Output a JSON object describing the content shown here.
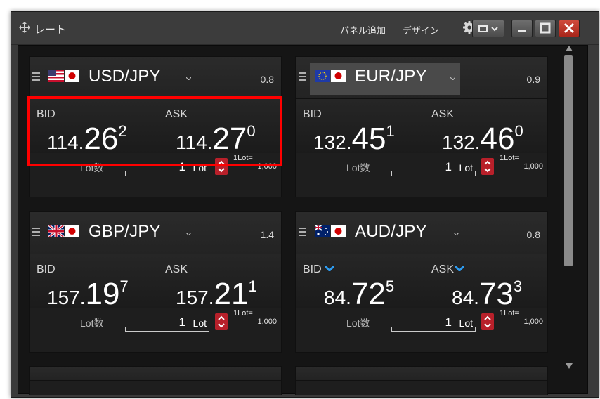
{
  "window": {
    "title": "レート",
    "add_panel_label": "パネル追加",
    "design_label": "デザイン"
  },
  "colors": {
    "accent_red": "#b8202a",
    "highlight": "#ff0000",
    "down_arrow_blue": "#2e9cf0"
  },
  "panels": [
    {
      "pair": "USD/JPY",
      "spread": "0.8",
      "flags": [
        "flag-us-icon",
        "flag-jp-icon"
      ],
      "bid_label": "BID",
      "ask_label": "ASK",
      "bid": {
        "prefix": "114.",
        "main": "26",
        "pip": "2"
      },
      "ask": {
        "prefix": "114.",
        "main": "27",
        "pip": "0"
      },
      "lot_label": "Lot数",
      "lot_value": "1",
      "lot_unit": "Lot",
      "lot_note_1": "1Lot=",
      "lot_note_2": "1,000"
    },
    {
      "pair": "EUR/JPY",
      "spread": "0.9",
      "flags": [
        "flag-eu-icon",
        "flag-jp-icon"
      ],
      "bid_label": "BID",
      "ask_label": "ASK",
      "bid": {
        "prefix": "132.",
        "main": "45",
        "pip": "1"
      },
      "ask": {
        "prefix": "132.",
        "main": "46",
        "pip": "0"
      },
      "lot_label": "Lot数",
      "lot_value": "1",
      "lot_unit": "Lot",
      "lot_note_1": "1Lot=",
      "lot_note_2": "1,000"
    },
    {
      "pair": "GBP/JPY",
      "spread": "1.4",
      "flags": [
        "flag-gb-icon",
        "flag-jp-icon"
      ],
      "bid_label": "BID",
      "ask_label": "ASK",
      "bid": {
        "prefix": "157.",
        "main": "19",
        "pip": "7"
      },
      "ask": {
        "prefix": "157.",
        "main": "21",
        "pip": "1"
      },
      "lot_label": "Lot数",
      "lot_value": "1",
      "lot_unit": "Lot",
      "lot_note_1": "1Lot=",
      "lot_note_2": "1,000"
    },
    {
      "pair": "AUD/JPY",
      "spread": "0.8",
      "flags": [
        "flag-au-icon",
        "flag-jp-icon"
      ],
      "bid_label": "BID",
      "ask_label": "ASK",
      "bid": {
        "prefix": "84.",
        "main": "72",
        "pip": "5"
      },
      "ask": {
        "prefix": "84.",
        "main": "73",
        "pip": "3"
      },
      "lot_label": "Lot数",
      "lot_value": "1",
      "lot_unit": "Lot",
      "lot_note_1": "1Lot=",
      "lot_note_2": "1,000"
    }
  ]
}
